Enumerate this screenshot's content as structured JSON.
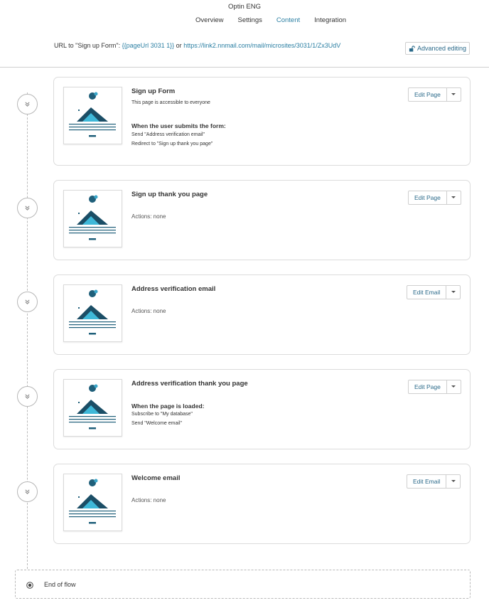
{
  "header": {
    "app_title": "Optin ENG",
    "tabs": [
      {
        "label": "Overview",
        "active": false
      },
      {
        "label": "Settings",
        "active": false
      },
      {
        "label": "Content",
        "active": true
      },
      {
        "label": "Integration",
        "active": false
      }
    ]
  },
  "url_bar": {
    "prefix": "URL to \"Sign up Form\": ",
    "placeholder_link": "{{pageUrl 3031 1}}",
    "separator": " or ",
    "url_link": "https://link2.nnmail.com/mail/microsites/3031/1/Zx3UdV",
    "advanced_editing_label": "Advanced editing"
  },
  "colors": {
    "accent": "#2b7fa3",
    "button_text": "#2b6a8a",
    "border": "#dcdcdc"
  },
  "steps": [
    {
      "title": "Sign up Form",
      "subtitle": "This page is accessible to everyone",
      "event_title": "When the user submits the form:",
      "event_lines": [
        "Send \"Address verification email\"",
        "Redirect to \"Sign up thank you page\""
      ],
      "actions_none": "",
      "edit_label": "Edit Page"
    },
    {
      "title": "Sign up thank you page",
      "subtitle": "",
      "event_title": "",
      "event_lines": [],
      "actions_none": "Actions: none",
      "edit_label": "Edit Page"
    },
    {
      "title": "Address verification email",
      "subtitle": "",
      "event_title": "",
      "event_lines": [],
      "actions_none": "Actions: none",
      "edit_label": "Edit Email"
    },
    {
      "title": "Address verification thank you page",
      "subtitle": "",
      "event_title": "When the page is loaded:",
      "event_lines": [
        "Subscribe to \"My database\"",
        "Send \"Welcome email\""
      ],
      "actions_none": "",
      "edit_label": "Edit Page"
    },
    {
      "title": "Welcome email",
      "subtitle": "",
      "event_title": "",
      "event_lines": [],
      "actions_none": "Actions: none",
      "edit_label": "Edit Email"
    }
  ],
  "end_of_flow_label": "End of flow",
  "icons": {
    "step_toggle": "double-chevron-down-icon",
    "lock": "unlock-icon",
    "end": "target-icon",
    "caret": "caret-down-icon"
  }
}
